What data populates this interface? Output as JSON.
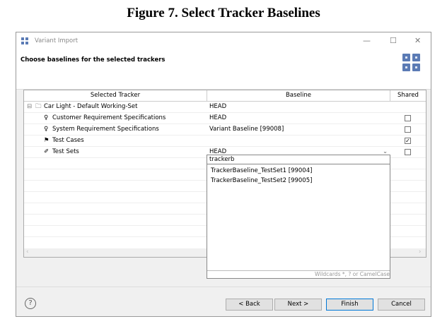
{
  "figure_title": "Figure 7. Select Tracker Baselines",
  "window": {
    "title": "Variant Import",
    "minimize": "—",
    "maximize": "☐",
    "close": "✕"
  },
  "header": {
    "title": "Choose baselines for the selected trackers"
  },
  "table": {
    "columns": [
      "Selected Tracker",
      "Baseline",
      "Shared"
    ],
    "rows": [
      {
        "label": "Car Light - Default Working-Set",
        "icon": "folder-icon",
        "baseline": "HEAD",
        "shared": null,
        "expander": "⊟"
      },
      {
        "label": "Customer Requirement Specifications",
        "icon": "lightbulb-icon",
        "baseline": "HEAD",
        "shared": false
      },
      {
        "label": "System Requirement Specifications",
        "icon": "lightbulb-icon",
        "baseline": "Variant Baseline [99008]",
        "shared": false
      },
      {
        "label": "Test Cases",
        "icon": "flag-icon",
        "baseline": "",
        "shared": true
      },
      {
        "label": "Test Sets",
        "icon": "wrench-icon",
        "baseline": "HEAD",
        "shared": false
      }
    ]
  },
  "dropdown": {
    "filter": "trackerb",
    "options": [
      "TrackerBaseline_TestSet1 [99004]",
      "TrackerBaseline_TestSet2 [99005]"
    ],
    "hint": "Wildcards *, ? or CamelCase"
  },
  "buttons": {
    "back": "< Back",
    "next": "Next >",
    "finish": "Finish",
    "cancel": "Cancel",
    "help": "?"
  }
}
